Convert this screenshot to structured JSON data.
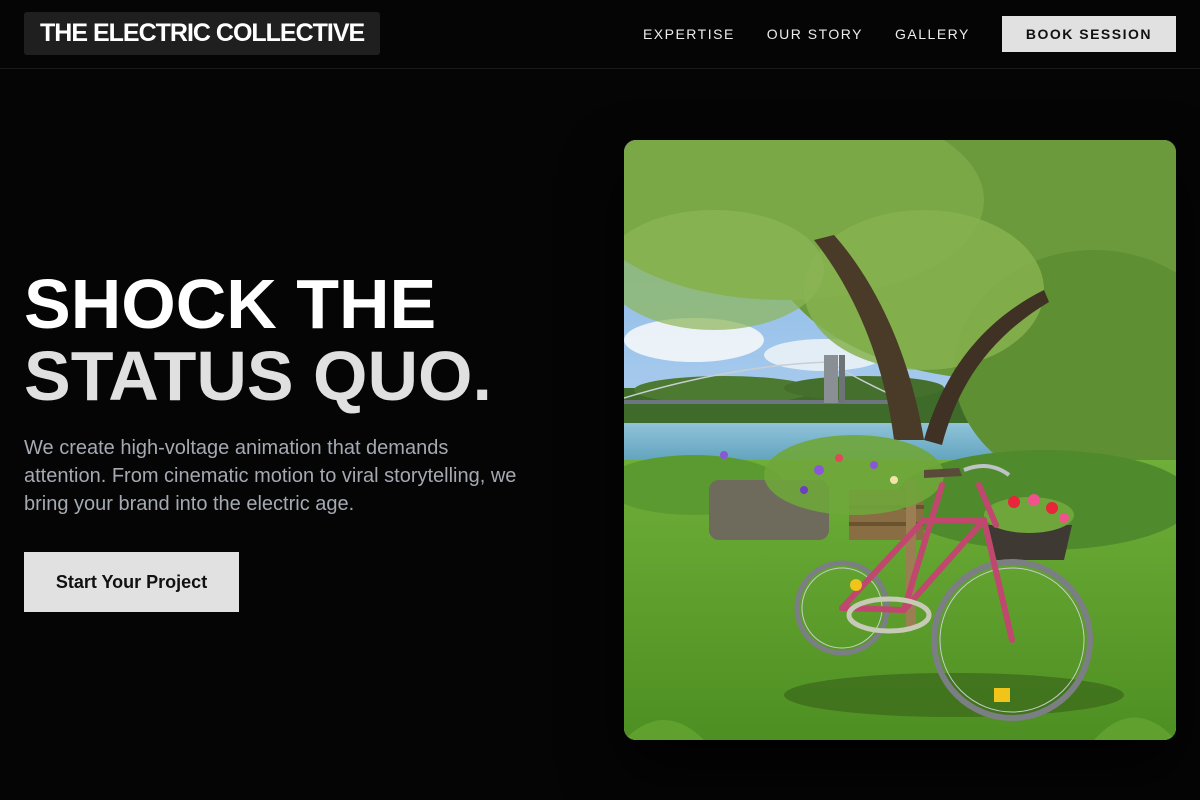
{
  "header": {
    "brand": "THE ELECTRIC COLLECTIVE",
    "nav": [
      {
        "label": "EXPERTISE"
      },
      {
        "label": "OUR STORY"
      },
      {
        "label": "GALLERY"
      }
    ],
    "cta_label": "BOOK SESSION"
  },
  "hero": {
    "headline_line1": "SHOCK THE",
    "headline_line2": "STATUS QUO.",
    "lead": "We create high-voltage animation that demands attention. From cinematic motion to viral storytelling, we bring your brand into the electric age.",
    "cta_label": "Start Your Project",
    "image_subject": "pink bicycle with flower crates under a willow tree by a river with a suspension bridge"
  },
  "colors": {
    "background": "#050505",
    "button_bg": "#e1e1e1",
    "button_text": "#111111",
    "lead_text": "#a4a9b2"
  }
}
